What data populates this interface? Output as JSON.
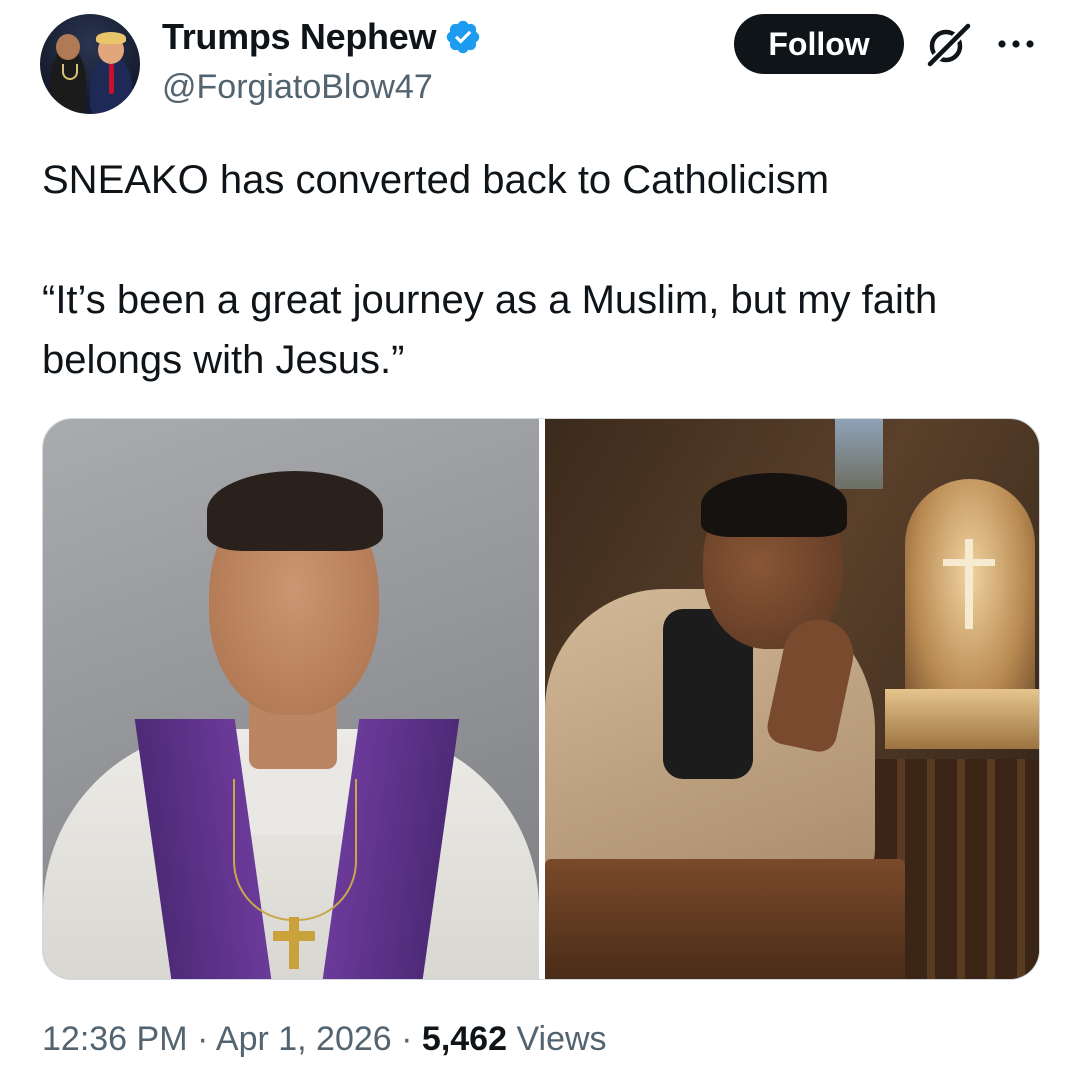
{
  "author": {
    "display_name": "Trumps Nephew",
    "handle": "@ForgiatoBlow47",
    "verified_icon": "verified-badge-icon"
  },
  "actions": {
    "follow_label": "Follow",
    "grok_icon": "grok-icon",
    "more_icon": "more-horizontal-icon"
  },
  "tweet": {
    "text": "SNEAKO has converted back to Catholicism\n\n“It’s been a great journey as a Muslim, but my faith belongs with Jesus.”"
  },
  "media": {
    "photos": [
      "photo-priest-stole",
      "photo-praying-church"
    ]
  },
  "meta": {
    "time": "12:36 PM",
    "separator": "·",
    "date": "Apr 1, 2026",
    "views_count": "5,462",
    "views_label": "Views"
  },
  "colors": {
    "primary_text": "#0f1419",
    "secondary_text": "#536471",
    "verified_blue": "#1d9bf0",
    "button_bg": "#0f1419",
    "border": "#cfd9de"
  }
}
